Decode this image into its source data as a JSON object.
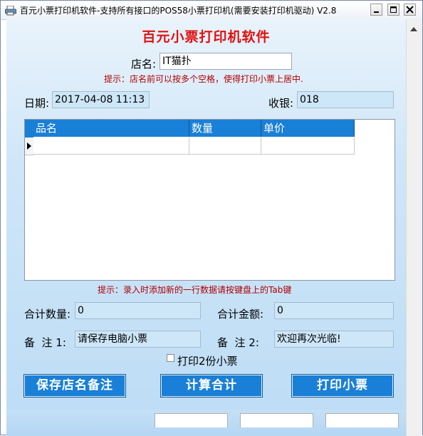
{
  "window": {
    "title": "百元小票打印机软件-支持所有接口的POS58小票打印机(需要安装打印机驱动)  V2.8"
  },
  "heading": "百元小票打印机软件",
  "store": {
    "label": "店名:",
    "value": "IT猫扑",
    "hint": "提示：店名前可以按多个空格，使得打印小票上居中."
  },
  "date": {
    "label": "日期:",
    "value": "2017-04-08 11:13"
  },
  "cashier": {
    "label": "收银:",
    "value": "018"
  },
  "grid": {
    "columns": [
      "品名",
      "数量",
      "单价"
    ],
    "row_marker": "▶"
  },
  "grid_hint": "提示：录入时添加新的一行数据请按键盘上的Tab键",
  "total_qty": {
    "label": "合计数量:",
    "value": "0"
  },
  "total_amount": {
    "label": "合计金额:",
    "value": "0"
  },
  "note1": {
    "label": "备  注 1:",
    "value": "请保存电脑小票"
  },
  "note2": {
    "label": "备  注 2:",
    "value": "欢迎再次光临!"
  },
  "print_twice": {
    "label": "打印2份小票",
    "checked": false
  },
  "buttons": {
    "save": "保存店名备注",
    "calc": "计算合计",
    "print": "打印小票"
  },
  "icons": {
    "app": "printer-icon",
    "minimize": "minimize-icon",
    "maximize": "maximize-icon",
    "close": "close-icon",
    "scroll_up": "scroll-up-arrow-icon"
  },
  "colors": {
    "accent": "#1a7fd6",
    "heading": "#e01010",
    "hint": "#b00000"
  }
}
